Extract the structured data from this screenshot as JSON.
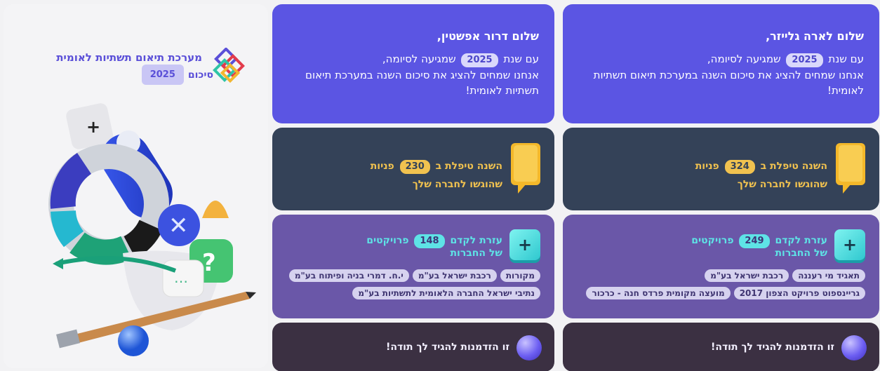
{
  "hero": {
    "title": "מערכת תיאום תשתיות לאומית",
    "subtitle": "סיכום",
    "year": "2025"
  },
  "cards": [
    {
      "greeting": "שלום לארה גלייזר,",
      "intro_pre": "עם שנת",
      "intro_year": "2025",
      "intro_post": "שמגיעה לסיומה,",
      "intro_rest": "אנחנו שמחים להציג את סיכום השנה במערכת תיאום תשתיות לאומית!",
      "inquiries_pre": "השנה טיפלת ב",
      "inquiries_count": "324",
      "inquiries_post": "פניות",
      "inquiries_line2": "שהוגשו לחברה שלך",
      "projects_pre": "עזרת לקדם",
      "projects_count": "249",
      "projects_post": "פרויקטים",
      "projects_line2": "של החברות",
      "companies": [
        "תאגיד מי רעננה",
        "רכבת ישראל בע\"מ",
        "גריינספוט פרויקט הצפון 2017",
        "מועצה מקומית פרדס חנה - כרכור"
      ],
      "thanks": "זו הזדמנות להגיד לך תודה!"
    },
    {
      "greeting": "שלום דרור אפשטין,",
      "intro_pre": "עם שנת",
      "intro_year": "2025",
      "intro_post": "שמגיעה לסיומה,",
      "intro_rest": "אנחנו שמחים להציג את סיכום השנה במערכת תיאום תשתיות לאומית!",
      "inquiries_pre": "השנה טיפלת ב",
      "inquiries_count": "230",
      "inquiries_post": "פניות",
      "inquiries_line2": "שהוגשו לחברה שלך",
      "projects_pre": "עזרת לקדם",
      "projects_count": "148",
      "projects_post": "פרויקטים",
      "projects_line2": "של החברות",
      "companies": [
        "מקורות",
        "רכבת ישראל בע\"מ",
        "י.ח. דמרי בניה ופיתוח בע\"מ",
        "נתיבי ישראל החברה הלאומית לתשתיות בע\"מ"
      ],
      "thanks": "זו הזדמנות להגיד לך תודה!"
    }
  ],
  "colors": {
    "accent": "#5b55e3",
    "inquiry_bg": "#344258",
    "project_bg": "#6a57a8",
    "thanks_bg": "#3b3042",
    "gold": "#f1c24f",
    "cyan": "#5ee3e6"
  },
  "icons": [
    "logo-icon",
    "speech-bubble-icon",
    "plus-icon",
    "orb-icon"
  ]
}
